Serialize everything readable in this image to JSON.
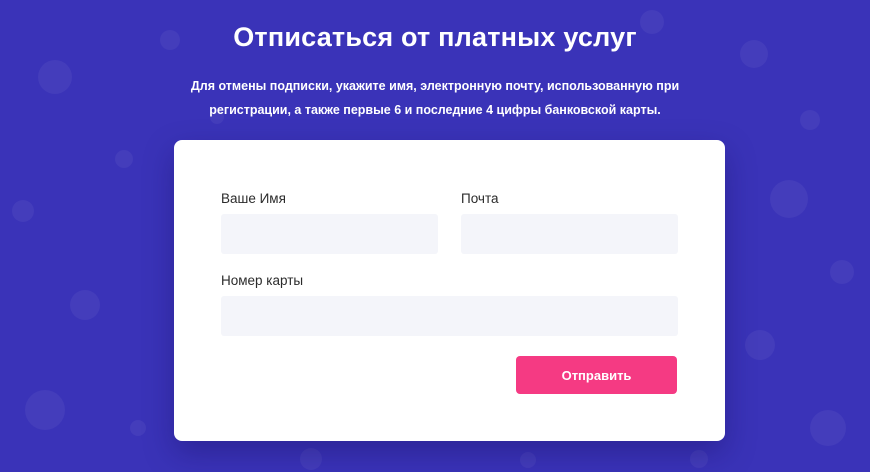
{
  "page": {
    "title": "Отписаться от платных услуг",
    "subtitle": "Для отмены подписки, укажите имя, электронную почту, использованную при регистрации, а также первые 6 и последние 4 цифры банковской карты."
  },
  "form": {
    "name_label": "Ваше Имя",
    "name_value": "",
    "email_label": "Почта",
    "email_value": "",
    "card_label": "Номер карты",
    "card_value": "",
    "submit_label": "Отправить"
  },
  "colors": {
    "background": "#3a33b8",
    "card": "#ffffff",
    "field": "#f4f5fa",
    "accent": "#f53a83"
  }
}
